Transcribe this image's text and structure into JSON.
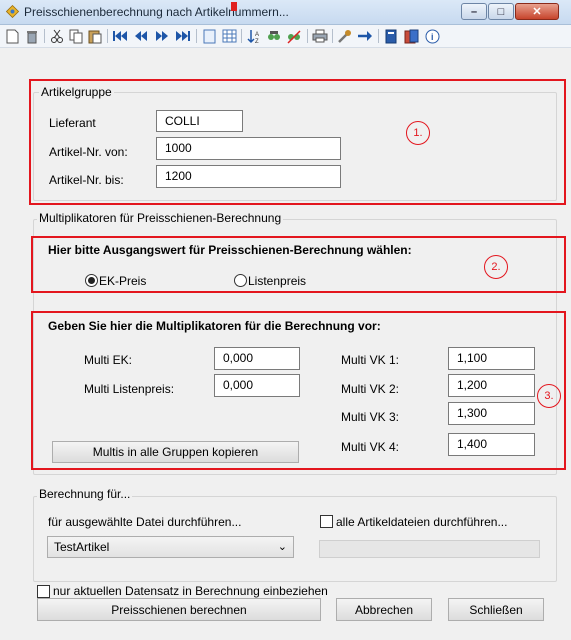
{
  "window": {
    "title": "Preisschienenberechnung nach Artikelnummern...",
    "min_glyph": "–",
    "max_glyph": "□",
    "close_glyph": "✕"
  },
  "toolbar": {
    "icons": [
      "new-document-icon",
      "delete-icon",
      "cut-icon",
      "copy-icon",
      "paste-icon",
      "first-record-icon",
      "previous-record-icon",
      "next-record-icon",
      "last-record-icon",
      "form-view-icon",
      "table-view-icon",
      "sort-icon",
      "filter-icon",
      "filter-remove-icon",
      "print-icon",
      "tools-icon",
      "go-icon",
      "book-icon",
      "help-book-icon",
      "info-icon"
    ]
  },
  "artikelgruppe": {
    "group_label": "Artikelgruppe",
    "lieferant_label": "Lieferant",
    "lieferant_value": "COLLI",
    "von_label": "Artikel-Nr. von:",
    "von_value": "1000",
    "bis_label": "Artikel-Nr. bis:",
    "bis_value": "1200",
    "marker": "1."
  },
  "multiplikatoren": {
    "group_label": "Multiplikatoren für Preisschienen-Berechnung",
    "ausgangswert_heading": "Hier bitte Ausgangswert für Preisschienen-Berechnung wählen:",
    "radio_ek": "EK-Preis",
    "radio_liste": "Listenpreis",
    "selected": "EK-Preis",
    "marker2": "2.",
    "multi_heading": "Geben Sie hier die Multiplikatoren für die Berechnung vor:",
    "multi_ek_label": "Multi EK:",
    "multi_ek_value": "0,000",
    "multi_liste_label": "Multi Listenpreis:",
    "multi_liste_value": "0,000",
    "vk1_label": "Multi VK 1:",
    "vk1_value": "1,100",
    "vk2_label": "Multi VK 2:",
    "vk2_value": "1,200",
    "vk3_label": "Multi VK 3:",
    "vk3_value": "1,300",
    "vk4_label": "Multi VK 4:",
    "vk4_value": "1,400",
    "copy_button": "Multis in alle Gruppen kopieren",
    "marker3": "3."
  },
  "berechnung": {
    "group_label": "Berechnung für...",
    "ausgewaehlt_label": "für ausgewählte Datei durchführen...",
    "alle_label": "alle Artikeldateien durchführen...",
    "select_value": "TestArtikel"
  },
  "footer": {
    "nur_aktuell_label": "nur aktuellen Datensatz in Berechnung einbeziehen",
    "berechnen_button": "Preisschienen berechnen",
    "abbrechen_button": "Abbrechen",
    "schliessen_button": "Schließen"
  },
  "colors": {
    "highlight": "#e3161e"
  }
}
